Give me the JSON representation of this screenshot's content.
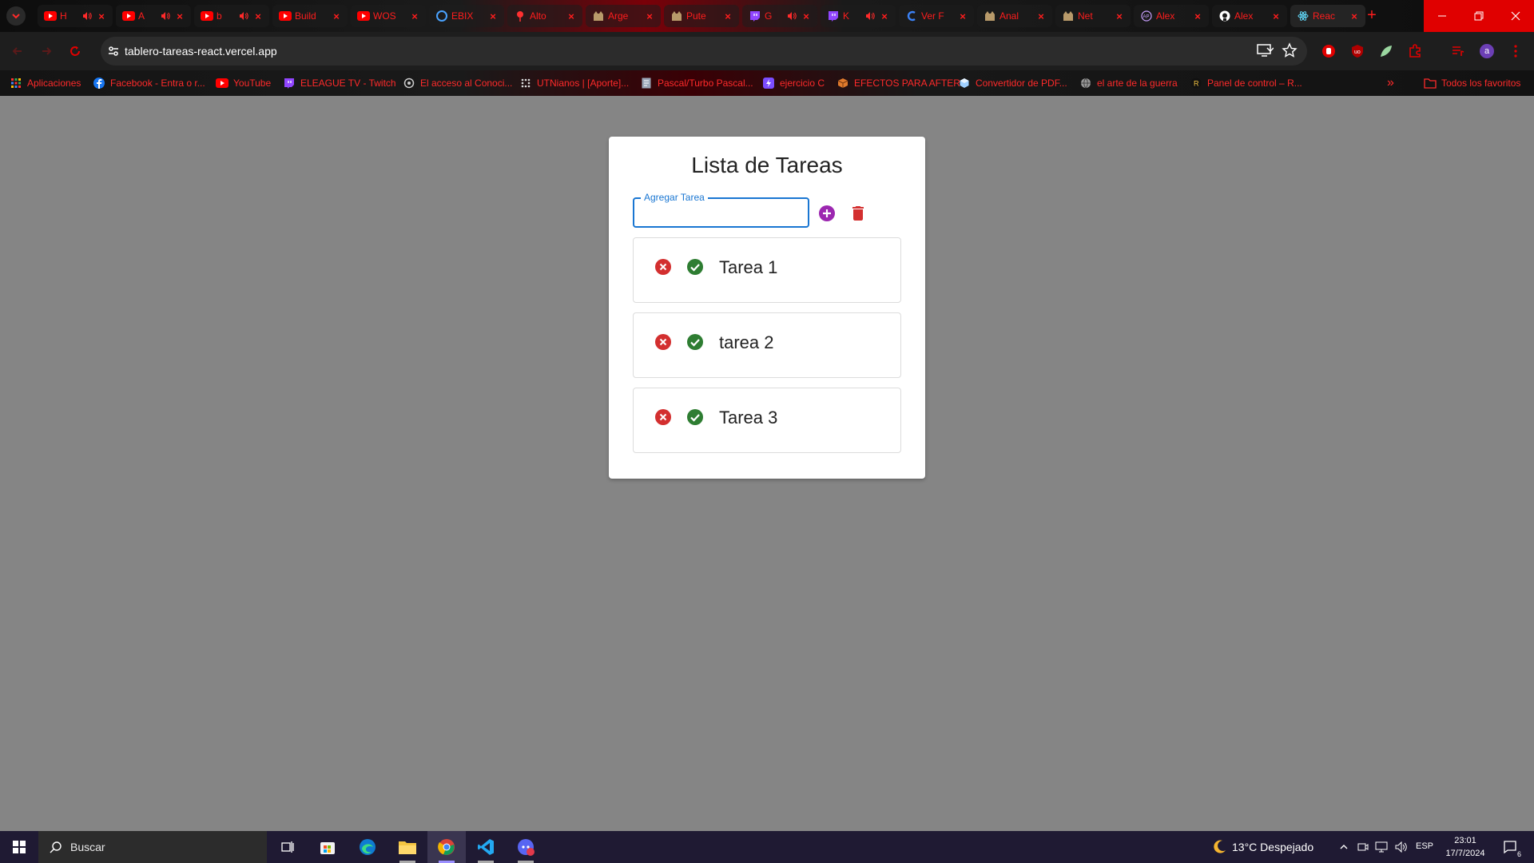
{
  "browser": {
    "tabs": [
      {
        "title": "H",
        "icon": "youtube-icon",
        "audio": true
      },
      {
        "title": "A",
        "icon": "youtube-icon",
        "audio": true
      },
      {
        "title": "b",
        "icon": "youtube-icon",
        "audio": true
      },
      {
        "title": "Build",
        "icon": "youtube-icon",
        "audio": false
      },
      {
        "title": "WOS",
        "icon": "youtube-icon",
        "audio": false
      },
      {
        "title": "EBIX",
        "icon": "circle-c-icon",
        "audio": false
      },
      {
        "title": "Alto",
        "icon": "pin-icon",
        "audio": false
      },
      {
        "title": "Arge",
        "icon": "cat-icon",
        "audio": false
      },
      {
        "title": "Pute",
        "icon": "cat-icon",
        "audio": false
      },
      {
        "title": "G",
        "icon": "twitch-icon",
        "audio": true
      },
      {
        "title": "K",
        "icon": "twitch-icon",
        "audio": true
      },
      {
        "title": "Ver F",
        "icon": "c-logo-icon",
        "audio": false
      },
      {
        "title": "Anal",
        "icon": "cat-icon",
        "audio": false
      },
      {
        "title": "Net",
        "icon": "cat-icon",
        "audio": false
      },
      {
        "title": "Alex",
        "icon": "ap-logo-icon",
        "audio": false
      },
      {
        "title": "Alex",
        "icon": "github-icon",
        "audio": false
      },
      {
        "title": "Reac",
        "icon": "react-icon",
        "audio": false
      }
    ],
    "active_tab_index": 16,
    "url": "tablero-tareas-react.vercel.app",
    "profile_initial": "a",
    "bookmarks": [
      {
        "label": "Aplicaciones",
        "icon": "apps-grid-icon"
      },
      {
        "label": "Facebook - Entra o r...",
        "icon": "facebook-icon"
      },
      {
        "label": "YouTube",
        "icon": "youtube-icon"
      },
      {
        "label": "ELEAGUE TV - Twitch",
        "icon": "twitch-icon"
      },
      {
        "label": "El acceso al Conoci...",
        "icon": "swirl-icon"
      },
      {
        "label": "UTNianos | [Aporte]...",
        "icon": "dots-icon"
      },
      {
        "label": "Pascal/Turbo Pascal...",
        "icon": "page-icon"
      },
      {
        "label": "ejercicio C",
        "icon": "bolt-icon"
      },
      {
        "label": "EFECTOS PARA AFTER",
        "icon": "cube-icon"
      },
      {
        "label": "Convertidor de PDF...",
        "icon": "hex-icon"
      },
      {
        "label": "el arte de la guerra",
        "icon": "globe-icon"
      },
      {
        "label": "Panel de control – R...",
        "icon": "r-logo-icon"
      }
    ],
    "bookmarks_overflow": "»",
    "all_bookmarks_label": "Todos los favoritos"
  },
  "app": {
    "title": "Lista de Tareas",
    "input_label": "Agregar Tarea",
    "input_value": "",
    "tasks": [
      {
        "label": "Tarea 1"
      },
      {
        "label": "tarea 2"
      },
      {
        "label": "Tarea 3"
      }
    ],
    "colors": {
      "accent": "#1976d2",
      "add": "#9c27b0",
      "delete": "#d32f2f",
      "done": "#2e7d32"
    }
  },
  "taskbar": {
    "search_placeholder": "Buscar",
    "weather": "13°C  Despejado",
    "language": "ESP",
    "time": "23:01",
    "date": "17/7/2024",
    "notifications": "6"
  }
}
